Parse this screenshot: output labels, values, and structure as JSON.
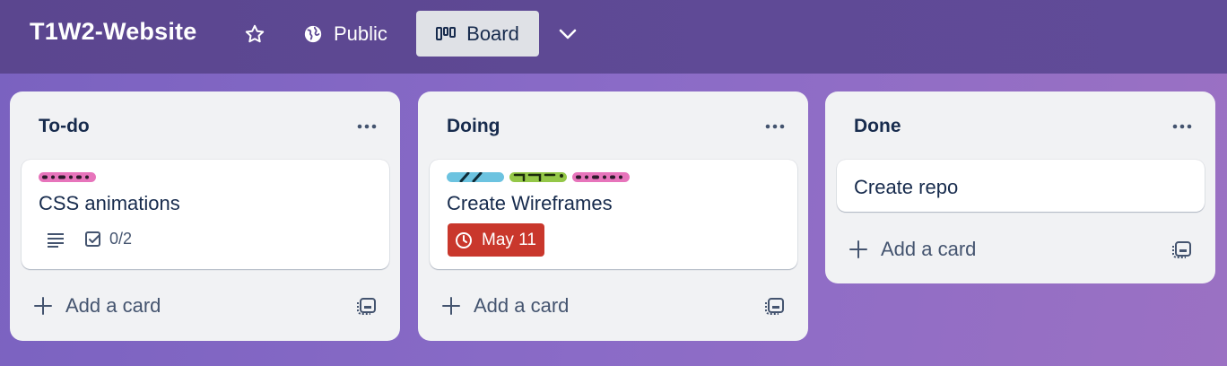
{
  "board": {
    "title": "T1W2-Website",
    "visibility_label": "Public",
    "view_label": "Board"
  },
  "lists": [
    {
      "title": "To-do",
      "cards": [
        {
          "title": "CSS animations",
          "labels": [
            {
              "color": "#e774bb"
            }
          ],
          "checklist": "0/2",
          "has_description": true
        }
      ],
      "add_card_label": "Add a card"
    },
    {
      "title": "Doing",
      "cards": [
        {
          "title": "Create Wireframes",
          "labels": [
            {
              "color": "#6cc3e0"
            },
            {
              "color": "#94c748"
            },
            {
              "color": "#e774bb"
            }
          ],
          "due": "May 11",
          "due_color": "#c9372c"
        }
      ],
      "add_card_label": "Add a card"
    },
    {
      "title": "Done",
      "cards": [
        {
          "title": "Create repo"
        }
      ],
      "add_card_label": "Add a card"
    }
  ],
  "icons": {
    "star": "star-icon",
    "visibility": "globe-icon",
    "view": "board-icon",
    "chevron": "chevron-down-icon",
    "list_menu": "more-icon",
    "add": "plus-icon",
    "template": "card-template-icon",
    "description": "description-icon",
    "checklist": "checklist-icon",
    "due": "clock-icon"
  }
}
